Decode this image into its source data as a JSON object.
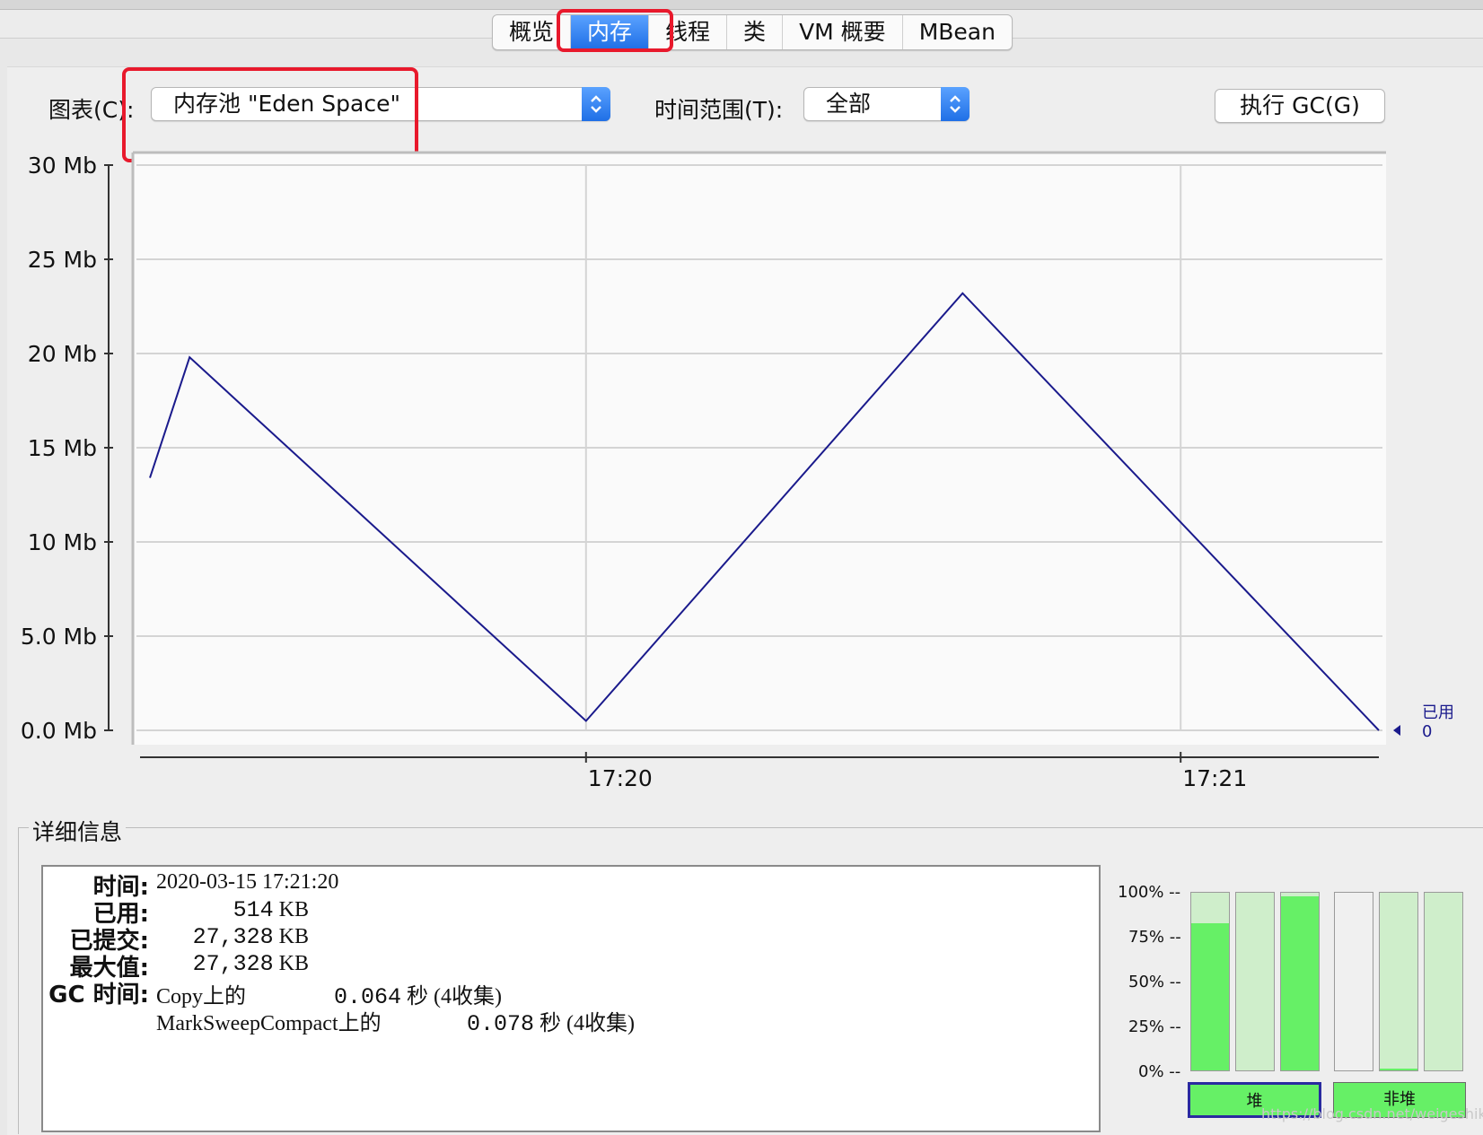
{
  "tabs": [
    {
      "label": "概览",
      "active": false
    },
    {
      "label": "内存",
      "active": true
    },
    {
      "label": "线程",
      "active": false
    },
    {
      "label": "类",
      "active": false
    },
    {
      "label": "VM 概要",
      "active": false
    },
    {
      "label": "MBean",
      "active": false
    }
  ],
  "toolbar": {
    "chart_label": "图表(C):",
    "chart_value": "内存池 \"Eden Space\"",
    "range_label": "时间范围(T):",
    "range_value": "全部",
    "gc_button": "执行 GC(G)"
  },
  "chart_data": {
    "type": "line",
    "y_ticks": [
      "30 Mb",
      "25 Mb",
      "20 Mb",
      "15 Mb",
      "10 Mb",
      "5.0 Mb",
      "0.0 Mb"
    ],
    "ylim": [
      0,
      30
    ],
    "x_ticks": [
      "17:20",
      "17:21"
    ],
    "xlim": [
      "17:19:15",
      "17:21:20"
    ],
    "series": [
      {
        "name": "已用",
        "color": "#1a1a8c",
        "x": [
          "17:19:16",
          "17:19:20",
          "17:20:00",
          "17:20:38",
          "17:21:20"
        ],
        "values": [
          13.4,
          19.8,
          0.5,
          23.2,
          0.0
        ]
      }
    ],
    "current_label": "已用",
    "current_value": "0",
    "grid": true
  },
  "details": {
    "title": "详细信息",
    "time_label": "时间:",
    "time_value": "2020-03-15 17:21:20",
    "used_label": "已用:",
    "used_value": "514",
    "committed_label": "已提交:",
    "committed_value": "27,328",
    "max_label": "最大值:",
    "max_value": "27,328",
    "unit": "KB",
    "gc_label": "GC 时间:",
    "gc_rows": [
      {
        "name": "Copy上的",
        "time": "0.064",
        "unit": "秒",
        "count": "(4收集)"
      },
      {
        "name": "MarkSweepCompact上的",
        "time": "0.078",
        "unit": "秒",
        "count": "(4收集)"
      }
    ]
  },
  "pools": {
    "scale": [
      "100% --",
      "75% --",
      "50% --",
      "25% --",
      "0% --"
    ],
    "heap_bars": [
      0.83,
      0,
      0.98
    ],
    "nonheap_bars": [
      0,
      0.01,
      0
    ],
    "heap_button": "堆",
    "nonheap_button": "非堆"
  },
  "watermark": "https://blog.csdn.net/weigeshikebi"
}
